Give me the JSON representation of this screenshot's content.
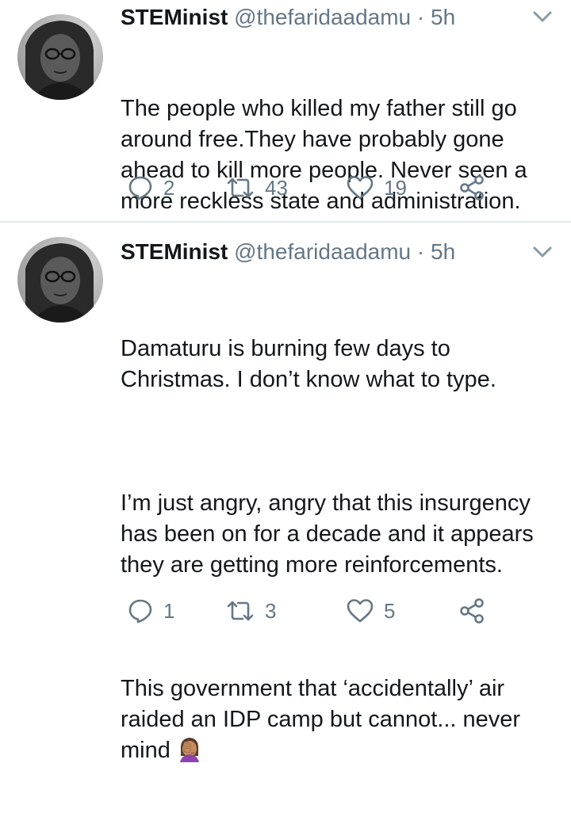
{
  "tweets": [
    {
      "author_name": "STEMinist",
      "handle": "@thefaridaadamu",
      "separator": "·",
      "time": "5h",
      "paragraphs": [
        "The people who killed my father still go around free.They have probably gone ahead to kill more people. Never seen a more reckless state and administration."
      ],
      "replies": "2",
      "retweets": "43",
      "likes": "19"
    },
    {
      "author_name": "STEMinist",
      "handle": "@thefaridaadamu",
      "separator": "·",
      "time": "5h",
      "paragraphs": [
        "Damaturu is burning few days to Christmas. I don’t know what to type.",
        "I’m just angry, angry that this insurgency has been on for a decade and it appears they are getting more reinforcements.",
        "This government that ‘accidentally’ air raided an IDP camp but cannot... never mind"
      ],
      "emoji": "woman-facepalming",
      "replies": "1",
      "retweets": "3",
      "likes": "5"
    }
  ],
  "colors": {
    "text": "#14171a",
    "secondary": "#657786",
    "divider": "#e6ecf0"
  },
  "icons": {
    "reply": "reply-icon",
    "retweet": "retweet-icon",
    "like": "heart-icon",
    "share": "share-icon",
    "menu": "chevron-down-icon"
  }
}
